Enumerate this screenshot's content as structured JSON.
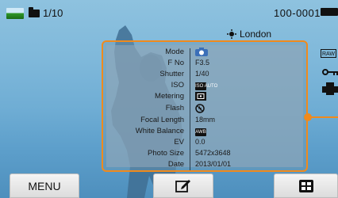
{
  "top": {
    "counter": "1/10",
    "file_number": "100-0001"
  },
  "location": {
    "name": "London"
  },
  "right_icons": {
    "raw_label": "RAW"
  },
  "info": {
    "rows": [
      {
        "label": "Mode",
        "value": ""
      },
      {
        "label": "F No",
        "value": "F3.5"
      },
      {
        "label": "Shutter",
        "value": "1/40"
      },
      {
        "label": "ISO",
        "value": ""
      },
      {
        "label": "Metering",
        "value": ""
      },
      {
        "label": "Flash",
        "value": ""
      },
      {
        "label": "Focal Length",
        "value": "18mm"
      },
      {
        "label": "White Balance",
        "value": ""
      },
      {
        "label": "EV",
        "value": "0.0"
      },
      {
        "label": "Photo Size",
        "value": "5472x3648"
      },
      {
        "label": "Date",
        "value": "2013/01/01"
      }
    ],
    "iso_icon_text": "ISO AUTO",
    "wb_icon_text": "AWB"
  },
  "buttons": {
    "menu_label": "MENU"
  },
  "colors": {
    "accent": "#f08a1c",
    "sky": "#7fb8da"
  }
}
